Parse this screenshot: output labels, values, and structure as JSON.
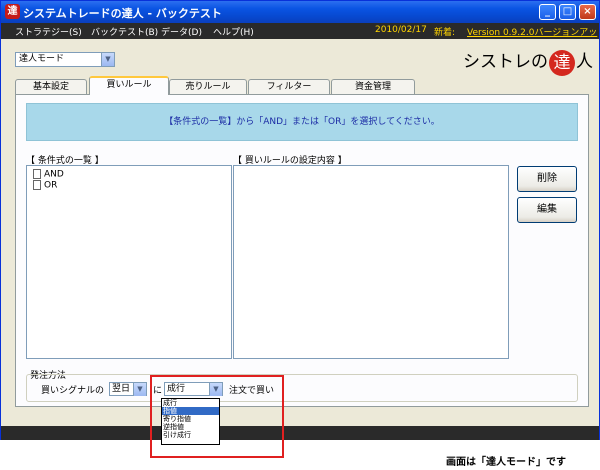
{
  "window": {
    "title": "システムトレードの達人 - バックテスト",
    "app_icon": "達",
    "minimize_label": "_",
    "maximize_label": "□",
    "close_label": "×"
  },
  "menu": {
    "items": [
      {
        "label": "ストラテジー(S)"
      },
      {
        "label": "バックテスト(B)"
      },
      {
        "label": "データ(D)"
      },
      {
        "label": "ヘルプ(H)"
      }
    ],
    "date": "2010/02/17",
    "new_label": "新着:",
    "version_link": "Version 0.9.2.0バージョンアッ"
  },
  "mode_select": {
    "value": "達人モード"
  },
  "brand": {
    "prefix": "シストレの",
    "seal": "達",
    "suffix": "人"
  },
  "tabs": [
    {
      "label": "基本設定",
      "active": false
    },
    {
      "label": "買いルール",
      "active": true
    },
    {
      "label": "売りルール",
      "active": false
    },
    {
      "label": "フィルター",
      "active": false
    },
    {
      "label": "資金管理",
      "active": false
    }
  ],
  "banner": {
    "text": "【条件式の一覧】から「AND」または「OR」を選択してください。"
  },
  "list_section": {
    "label": "【 条件式の一覧 】",
    "items": [
      {
        "label": "AND"
      },
      {
        "label": "OR"
      }
    ]
  },
  "detail_section": {
    "label": "【 買いルールの設定内容 】"
  },
  "buttons": {
    "delete": "削除",
    "edit": "編集"
  },
  "order": {
    "group_label": "発注方法",
    "signal_label": "買いシグナルの",
    "day_select": "翌日",
    "particle": "に",
    "type_select": "成行",
    "suffix": "注文で買い",
    "options": [
      {
        "label": "成行",
        "selected": false
      },
      {
        "label": "指値",
        "selected": true
      },
      {
        "label": "寄り指値",
        "selected": false
      },
      {
        "label": "逆指値",
        "selected": false
      },
      {
        "label": "引け成行",
        "selected": false
      }
    ]
  },
  "caption": "画面は「達人モード」です",
  "colors": {
    "titlebar": "#0a54e3",
    "menubar": "#2a2a2a",
    "banner": "#a8d8ea",
    "highlight": "#e02020",
    "seal": "#d4281e"
  }
}
